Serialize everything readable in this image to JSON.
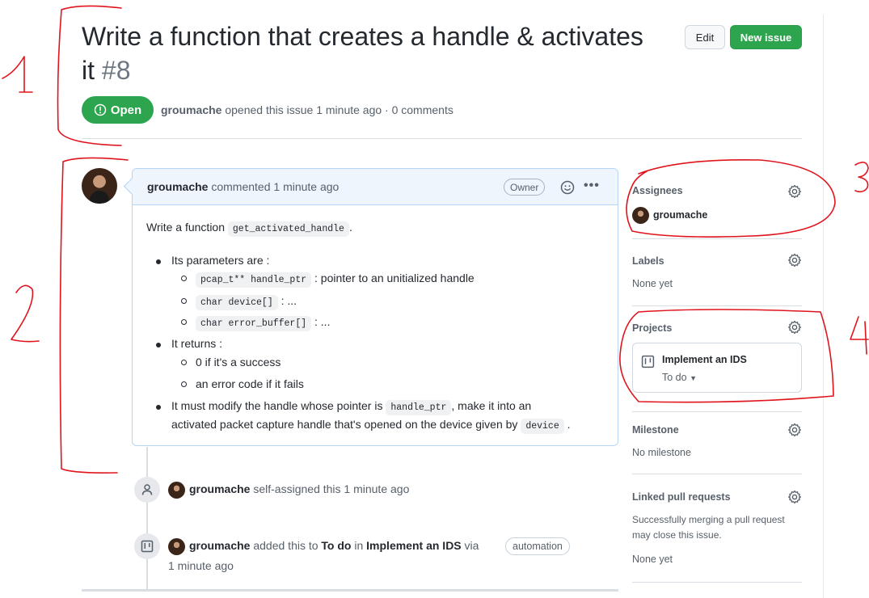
{
  "issue": {
    "title": "Write a function that creates a handle & activates it",
    "number": "#8",
    "state": "Open",
    "author": "groumache",
    "opened_text": "opened this issue 1 minute ago · 0 comments"
  },
  "header_buttons": {
    "edit": "Edit",
    "new_issue": "New issue"
  },
  "comment": {
    "author": "groumache",
    "action": "commented 1 minute ago",
    "badge": "Owner",
    "intro_prefix": "Write a function",
    "intro_code": "get_activated_handle",
    "intro_suffix": ".",
    "params_label": "Its parameters are :",
    "param1_code": "pcap_t** handle_ptr",
    "param1_text": ": pointer to an unitialized handle",
    "param2_code": "char device[]",
    "param2_text": ": ...",
    "param3_code": "char error_buffer[]",
    "param3_text": ": ...",
    "returns_label": "It returns :",
    "return1": "0 if it's a success",
    "return2": "an error code if it fails",
    "modify_prefix": "It must modify the handle whose pointer is",
    "modify_code": "handle_ptr",
    "modify_mid": ", make it into an",
    "modify_line2": "activated packet capture handle that's opened on the device given by",
    "modify_code2": "device",
    "modify_suffix": "."
  },
  "timeline": {
    "event1_user": "groumache",
    "event1_text": "self-assigned this 1 minute ago",
    "event2_user": "groumache",
    "event2_pre": "added this to",
    "event2_column": "To do",
    "event2_in": "in",
    "event2_project": "Implement an IDS",
    "event2_via": "via",
    "event2_badge": "automation",
    "event2_time": "1 minute ago"
  },
  "sidebar": {
    "assignees_label": "Assignees",
    "assignee": "groumache",
    "labels_label": "Labels",
    "labels_value": "None yet",
    "projects_label": "Projects",
    "project_name": "Implement an IDS",
    "project_column": "To do",
    "milestone_label": "Milestone",
    "milestone_value": "No milestone",
    "linked_label": "Linked pull requests",
    "linked_desc1": "Successfully merging a pull request",
    "linked_desc2": "may close this issue.",
    "linked_value": "None yet"
  },
  "annotations": {
    "n1": "1",
    "n2": "2",
    "n3": "3",
    "n4": "4"
  },
  "colors": {
    "green": "#2da44e",
    "annotation_red": "#e0141c",
    "comment_border": "#b6d4f5"
  }
}
